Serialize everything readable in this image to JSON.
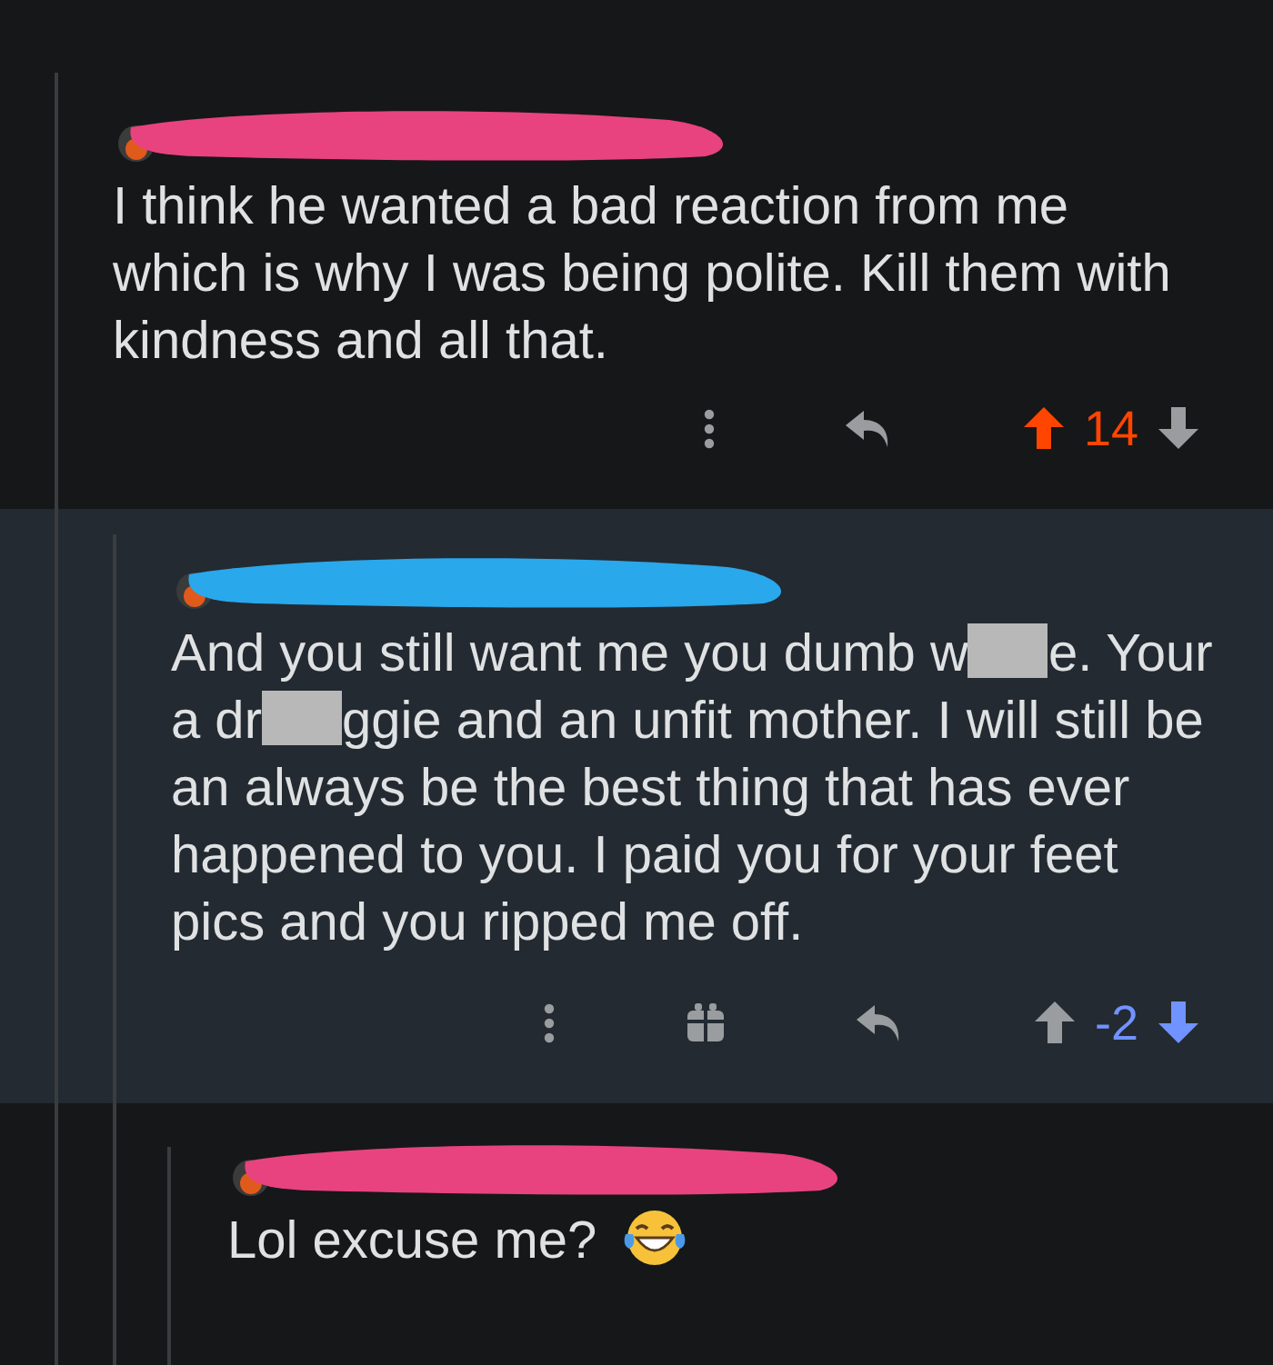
{
  "comments": [
    {
      "redaction": {
        "color": "#e8437e"
      },
      "body": [
        {
          "kind": "text",
          "text": "I think he wanted a bad reaction from me which is why I was being polite. Kill them with kindness and all that."
        }
      ],
      "actions": [
        {
          "kind": "more"
        },
        {
          "kind": "reply"
        }
      ],
      "score": "14",
      "upvoted": true,
      "downvoted": false
    },
    {
      "redaction": {
        "color": "#29a8ec"
      },
      "body": [
        {
          "kind": "text",
          "text": "And you still want me you dumb w"
        },
        {
          "kind": "censor"
        },
        {
          "kind": "text",
          "text": "e. Your a dr"
        },
        {
          "kind": "censor"
        },
        {
          "kind": "text",
          "text": "ggie and an unfit mother. I will still be an always be the best thing that has ever happened to you. I paid you for your feet pics and you ripped me off."
        }
      ],
      "actions": [
        {
          "kind": "more"
        },
        {
          "kind": "award"
        },
        {
          "kind": "reply"
        }
      ],
      "score": "-2",
      "upvoted": false,
      "downvoted": true
    },
    {
      "redaction": {
        "color": "#e8437e"
      },
      "body": [
        {
          "kind": "text",
          "text": "Lol excuse me?"
        },
        {
          "kind": "emoji"
        }
      ]
    }
  ]
}
